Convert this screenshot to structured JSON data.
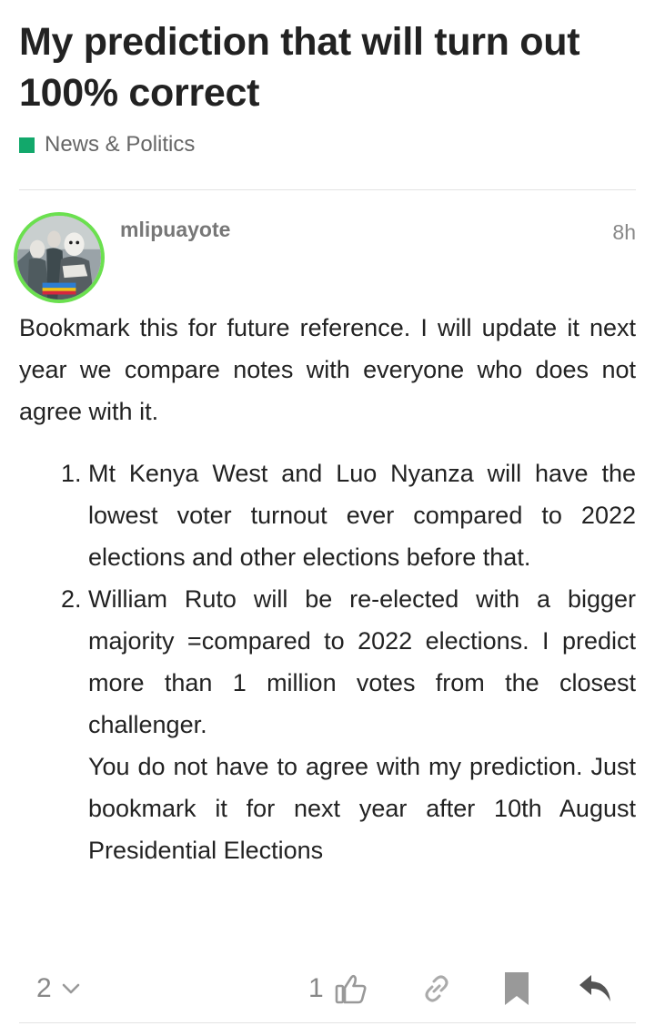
{
  "topic": {
    "title": "My prediction that will turn out 100% correct",
    "category": "News & Politics",
    "category_color": "#12a86b"
  },
  "post": {
    "username": "mlipuayote",
    "age": "8h",
    "avatar_border_color": "#6be04f",
    "intro": "Bookmark this for future reference. I will update it next year we compare notes with everyone who does not agree with it.",
    "list": [
      {
        "text": "Mt Kenya West and Luo Nyanza will have the lowest voter turnout ever compared to 2022 elections and other elections before that."
      },
      {
        "text": "William Ruto will be re-elected with a bigger majority =compared to 2022 elections. I predict more than 1 million votes from the closest challenger.",
        "extra": "You do not have to agree with my prediction. Just bookmark it for next year after 10th August Presidential Elections"
      }
    ]
  },
  "actions": {
    "replies_count": "2",
    "likes_count": "1",
    "icons": [
      "chevron-down-icon",
      "like-icon",
      "link-icon",
      "bookmark-icon",
      "reply-icon"
    ]
  }
}
